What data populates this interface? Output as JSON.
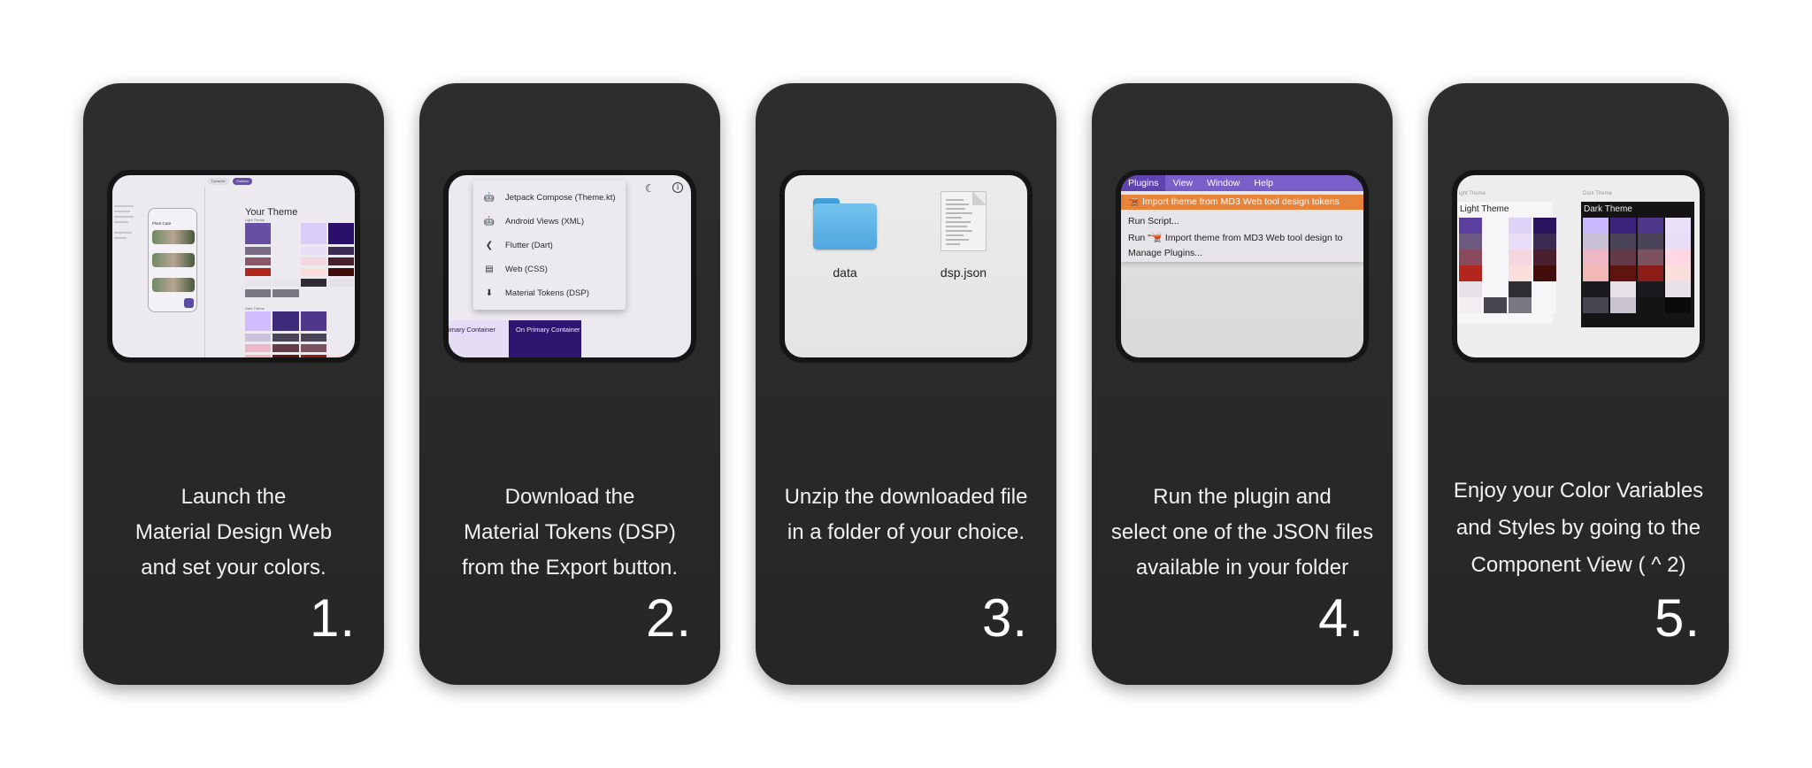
{
  "steps": [
    {
      "number": "1.",
      "caption": [
        "Launch the",
        "Material Design Web",
        "and set your colors."
      ],
      "screen": {
        "title": "Your Theme",
        "tabs": [
          "Dynamic",
          "Custom"
        ],
        "app_title": "Plant Care",
        "light_label": "Light Theme",
        "dark_label": "Dark Theme"
      }
    },
    {
      "number": "2.",
      "caption": [
        "Download the",
        "Material Tokens (DSP)",
        "from the Export button."
      ],
      "screen": {
        "menu_items": [
          {
            "icon": "android-icon",
            "glyph": "🤖",
            "label": "Jetpack Compose (Theme.kt)"
          },
          {
            "icon": "android-icon",
            "glyph": "🤖",
            "label": "Android Views (XML)"
          },
          {
            "icon": "flutter-icon",
            "glyph": "❮",
            "label": "Flutter (Dart)"
          },
          {
            "icon": "web-icon",
            "glyph": "▤",
            "label": "Web (CSS)"
          },
          {
            "icon": "download-icon",
            "glyph": "⬇",
            "label": "Material Tokens (DSP)"
          }
        ],
        "primary_container": "imary Container",
        "on_primary_container": "On Primary Container"
      }
    },
    {
      "number": "3.",
      "caption": [
        "Unzip the downloaded file",
        "in a folder of your choice."
      ],
      "screen": {
        "folder_label": "data",
        "file_label": "dsp.json"
      }
    },
    {
      "number": "4.",
      "caption": [
        "Run the plugin and",
        "select one of the JSON files",
        "available in your folder"
      ],
      "screen": {
        "menubar": [
          "Plugins",
          "View",
          "Window",
          "Help"
        ],
        "highlighted": "🫕 Import theme from MD3 Web tool design tokens",
        "items": [
          "Run Script...",
          "Run \"🫕 Import theme from MD3 Web tool design to",
          "Manage Plugins..."
        ]
      }
    },
    {
      "number": "5.",
      "caption": [
        "Enjoy your Color Variables",
        "and Styles by going to the",
        "Component View ( ^ 2)"
      ],
      "screen": {
        "light_small": "ight Theme",
        "light_title": "Light Theme",
        "dark_small": "Dark Theme",
        "dark_title": "Dark Theme"
      }
    }
  ],
  "colors": {
    "card_bg": "#2a2a2a",
    "primary": "#6750a4",
    "highlight": "#e8833a",
    "menubar": "#7a5ec9",
    "folder": "#5fb3e6"
  }
}
